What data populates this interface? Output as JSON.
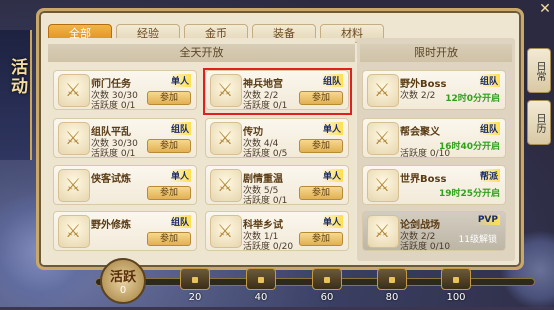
{
  "window": {
    "title": "活动"
  },
  "tabs": [
    {
      "label": "全部",
      "active": true
    },
    {
      "label": "经验",
      "active": false
    },
    {
      "label": "金币",
      "active": false
    },
    {
      "label": "装备",
      "active": false
    },
    {
      "label": "材料",
      "active": false
    }
  ],
  "sections": {
    "all_day": "全天开放",
    "limited": "限时开放"
  },
  "left_cards": [
    {
      "name": "师门任务",
      "tag": "单人",
      "count": "次数 30/30",
      "activity": "活跃度 0/1",
      "button": "参加"
    },
    {
      "name": "神兵地宫",
      "tag": "组队",
      "count": "次数 2/2",
      "activity": "活跃度 0/1",
      "button": "参加"
    },
    {
      "name": "组队平乱",
      "tag": "组队",
      "count": "次数 30/30",
      "activity": "活跃度 0/1",
      "button": "参加"
    },
    {
      "name": "传功",
      "tag": "单人",
      "count": "次数 4/4",
      "activity": "活跃度 0/5",
      "button": "参加"
    },
    {
      "name": "侠客试炼",
      "tag": "单人",
      "count": "",
      "activity": "",
      "button": "参加"
    },
    {
      "name": "剧情重温",
      "tag": "单人",
      "count": "次数 5/5",
      "activity": "活跃度 0/1",
      "button": "参加"
    },
    {
      "name": "野外修炼",
      "tag": "组队",
      "count": "",
      "activity": "",
      "button": "参加"
    },
    {
      "name": "科举乡试",
      "tag": "单人",
      "count": "次数 1/1",
      "activity": "活跃度 0/20",
      "button": "参加"
    }
  ],
  "right_cards": [
    {
      "name": "野外Boss",
      "tag": "组队",
      "count": "次数 2/2",
      "activity": "",
      "timer": "12时0分开启"
    },
    {
      "name": "帮会聚义",
      "tag": "组队",
      "count": "",
      "activity": "活跃度 0/10",
      "timer": "16时40分开启"
    },
    {
      "name": "世界Boss",
      "tag": "帮派",
      "count": "",
      "activity": "",
      "timer": "19时25分开启"
    },
    {
      "name": "论剑战场",
      "tag": "PVP",
      "count": "次数 2/2",
      "activity": "活跃度 0/10",
      "timer": "11级解锁"
    }
  ],
  "side_buttons": [
    {
      "label": "日常"
    },
    {
      "label": "日历"
    }
  ],
  "activity": {
    "label": "活跃",
    "value": "0",
    "milestones": [
      "20",
      "40",
      "60",
      "80",
      "100"
    ]
  },
  "icons": {
    "card_icon": "shield-sword-icon",
    "chest": "treasure-chest-icon",
    "close": "close-icon"
  }
}
